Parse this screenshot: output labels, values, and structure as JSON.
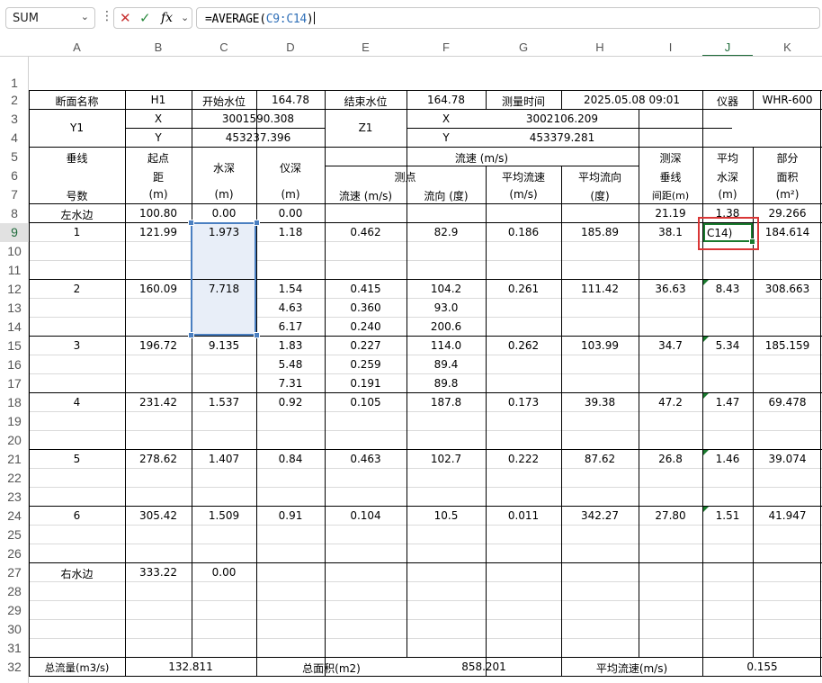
{
  "formula_bar": {
    "name_box": "SUM",
    "formula_prefix": "=AVERAGE(",
    "formula_ref": "C9:C14",
    "formula_suffix": ")"
  },
  "columns": [
    "A",
    "B",
    "C",
    "D",
    "E",
    "F",
    "G",
    "H",
    "I",
    "J",
    "K"
  ],
  "rows": [
    "1",
    "2",
    "3",
    "4",
    "5",
    "6",
    "7",
    "8",
    "9",
    "10",
    "11",
    "12",
    "13",
    "14",
    "15",
    "16",
    "17",
    "18",
    "19",
    "20",
    "21",
    "22",
    "23",
    "24",
    "25",
    "26",
    "27",
    "28",
    "29",
    "30",
    "31",
    "32"
  ],
  "header": {
    "r2": {
      "a": "断面名称",
      "b": "H1",
      "c": "开始水位",
      "d": "164.78",
      "e": "结束水位",
      "f": "164.78",
      "g": "测量时间",
      "h": "2025.05.08 09:01",
      "i": "仪器",
      "k": "WHR-600"
    },
    "r3": {
      "a": "Y1",
      "b": "X",
      "cd": "3001590.308",
      "e": "Z1",
      "f": "X",
      "gh": "3002106.209"
    },
    "r4": {
      "b": "Y",
      "cd": "453237.396",
      "f": "Y",
      "gh": "453379.281"
    },
    "a5": "垂线",
    "a7": "号数",
    "b5": "起点",
    "b6": "距",
    "b7": "(m)",
    "c6": "水深",
    "c7": "(m)",
    "d6": "仪深",
    "d7": "(m)",
    "ef5": "流速 (m/s)",
    "ef6": "测点",
    "e7": "流速 (m/s)",
    "f7": "流向 (度)",
    "g6": "平均流速",
    "g7": "(m/s)",
    "h6": "平均流向",
    "h7": "(度)",
    "i5": "测深",
    "i6": "垂线",
    "i7": "间距(m)",
    "j5": "平均",
    "j6": "水深",
    "j7": "(m)",
    "k5": "部分",
    "k6": "面积",
    "k7": "(m²)"
  },
  "data": {
    "r8": {
      "a": "左水边",
      "b": "100.80",
      "c": "0.00",
      "d": "0.00",
      "i": "21.19",
      "j": "1.38",
      "k": "29.266"
    },
    "r9": {
      "a": "1",
      "b": "121.99",
      "c": "1.973",
      "d": "1.18",
      "e": "0.462",
      "f": "82.9",
      "g": "0.186",
      "h": "185.89",
      "i": "38.1",
      "j": "C14)",
      "k": "184.614"
    },
    "r12": {
      "a": "2",
      "b": "160.09",
      "c": "7.718",
      "d": "1.54",
      "e": "0.415",
      "f": "104.2",
      "g": "0.261",
      "h": "111.42",
      "i": "36.63",
      "j": "8.43",
      "k": "308.663"
    },
    "r13": {
      "d": "4.63",
      "e": "0.360",
      "f": "93.0"
    },
    "r14": {
      "d": "6.17",
      "e": "0.240",
      "f": "200.6"
    },
    "r15": {
      "a": "3",
      "b": "196.72",
      "c": "9.135",
      "d": "1.83",
      "e": "0.227",
      "f": "114.0",
      "g": "0.262",
      "h": "103.99",
      "i": "34.7",
      "j": "5.34",
      "k": "185.159"
    },
    "r16": {
      "d": "5.48",
      "e": "0.259",
      "f": "89.4"
    },
    "r17": {
      "d": "7.31",
      "e": "0.191",
      "f": "89.8"
    },
    "r18": {
      "a": "4",
      "b": "231.42",
      "c": "1.537",
      "d": "0.92",
      "e": "0.105",
      "f": "187.8",
      "g": "0.173",
      "h": "39.38",
      "i": "47.2",
      "j": "1.47",
      "k": "69.478"
    },
    "r21": {
      "a": "5",
      "b": "278.62",
      "c": "1.407",
      "d": "0.84",
      "e": "0.463",
      "f": "102.7",
      "g": "0.222",
      "h": "87.62",
      "i": "26.8",
      "j": "1.46",
      "k": "39.074"
    },
    "r24": {
      "a": "6",
      "b": "305.42",
      "c": "1.509",
      "d": "0.91",
      "e": "0.104",
      "f": "10.5",
      "g": "0.011",
      "h": "342.27",
      "i": "27.80",
      "j": "1.51",
      "k": "41.947"
    },
    "r27": {
      "a": "右水边",
      "b": "333.22",
      "c": "0.00"
    }
  },
  "footer": {
    "a": "总流量(m3/s)",
    "bc": "132.811",
    "de": "总面积(m2)",
    "fg": "858.201",
    "hi": "平均流速(m/s)",
    "jk": "0.155"
  },
  "colors": {
    "accent": "#1e6b3a",
    "selection": "#4a7fc1",
    "highlight": "#d93636"
  }
}
